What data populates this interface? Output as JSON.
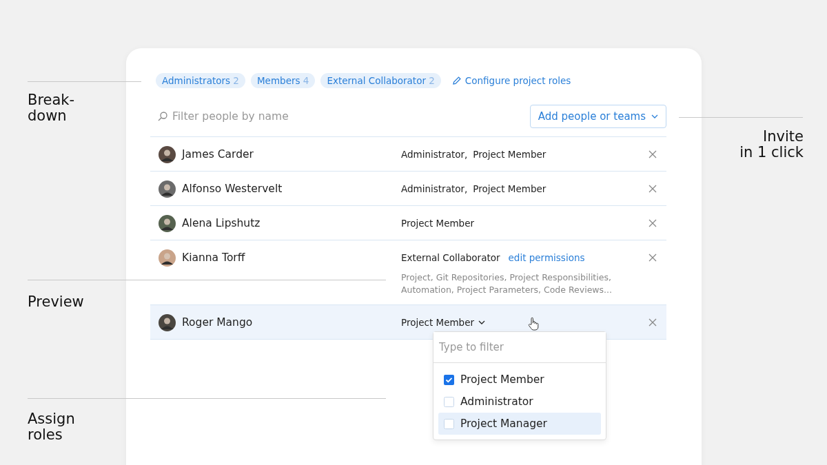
{
  "annotations": [
    {
      "lines": [
        "Break-",
        "down"
      ]
    },
    {
      "lines": [
        "Invite",
        "in 1 click"
      ]
    },
    {
      "lines": [
        "Preview"
      ]
    },
    {
      "lines": [
        "Assign",
        "roles"
      ]
    }
  ],
  "chips": [
    {
      "label": "Administrators",
      "count": "2"
    },
    {
      "label": "Members",
      "count": "4"
    },
    {
      "label": "External Collaborator",
      "count": "2"
    }
  ],
  "configure_link": "Configure project roles",
  "filter": {
    "placeholder": "Filter people by name"
  },
  "add_button": "Add people or teams",
  "people": [
    {
      "name": "James Carder",
      "roles": [
        "Administrator,",
        "Project Member"
      ],
      "selected": false
    },
    {
      "name": "Alfonso Westervelt",
      "roles": [
        "Administrator,",
        "Project Member"
      ],
      "selected": false
    },
    {
      "name": "Alena Lipshutz",
      "roles": [
        "Project Member"
      ],
      "selected": false
    },
    {
      "name": "Kianna Torff",
      "roles": [
        "External Collaborator"
      ],
      "link": "edit permissions",
      "permissions": "Project, Git Repositories, Project Responsibilities, Automation, Project Parameters, Code Reviews...",
      "selected": false
    },
    {
      "name": "Roger Mango",
      "roles": [
        "Project Member"
      ],
      "has_menu": true,
      "selected": true
    }
  ],
  "role_menu": {
    "placeholder": "Type to filter",
    "options": [
      {
        "label": "Project Member",
        "checked": true,
        "highlighted": false
      },
      {
        "label": "Administrator",
        "checked": false,
        "highlighted": false
      },
      {
        "label": "Project Manager",
        "checked": false,
        "highlighted": true
      }
    ]
  }
}
